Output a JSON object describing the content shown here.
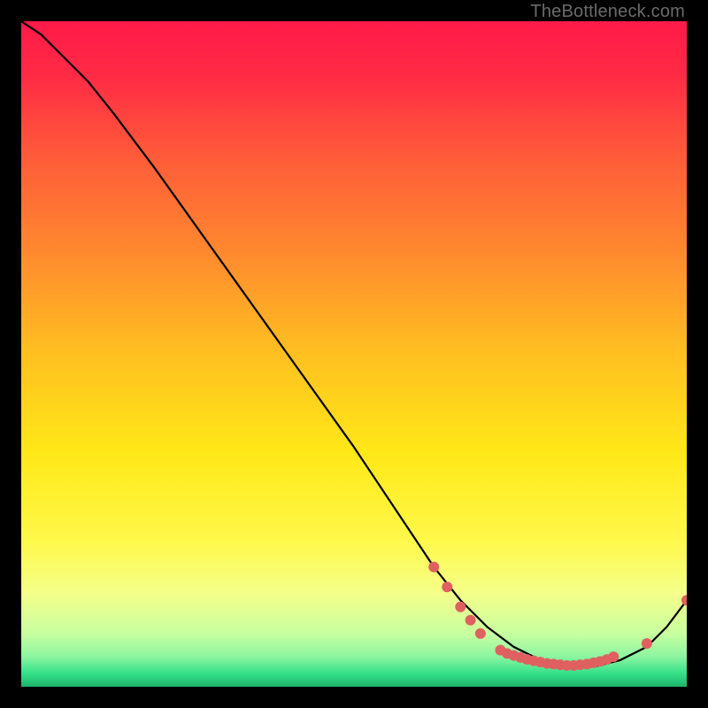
{
  "watermark": "TheBottleneck.com",
  "chart_data": {
    "type": "line",
    "title": "",
    "xlabel": "",
    "ylabel": "",
    "xlim": [
      0,
      100
    ],
    "ylim": [
      0,
      100
    ],
    "grid": false,
    "legend": false,
    "background_gradient": {
      "stops": [
        {
          "pos": 0.0,
          "color": "#ff1a49"
        },
        {
          "pos": 0.08,
          "color": "#ff2a45"
        },
        {
          "pos": 0.2,
          "color": "#ff5a3a"
        },
        {
          "pos": 0.35,
          "color": "#ff8a2e"
        },
        {
          "pos": 0.5,
          "color": "#ffc020"
        },
        {
          "pos": 0.65,
          "color": "#ffe818"
        },
        {
          "pos": 0.78,
          "color": "#fff94a"
        },
        {
          "pos": 0.86,
          "color": "#f4ff8a"
        },
        {
          "pos": 0.92,
          "color": "#c8ffa0"
        },
        {
          "pos": 0.955,
          "color": "#8cf5a0"
        },
        {
          "pos": 0.98,
          "color": "#35e08a"
        },
        {
          "pos": 1.0,
          "color": "#1db36a"
        }
      ]
    },
    "series": [
      {
        "name": "curve",
        "color": "#000000",
        "x": [
          0,
          3,
          6,
          10,
          14,
          20,
          30,
          40,
          50,
          58,
          62,
          66,
          70,
          74,
          78,
          82,
          86,
          90,
          94,
          97,
          100
        ],
        "y": [
          100,
          98,
          95,
          91,
          86,
          78,
          64,
          50,
          36,
          24,
          18,
          13,
          9,
          6,
          4,
          3,
          3,
          4,
          6,
          9,
          13
        ]
      }
    ],
    "markers": {
      "color": "#e06060",
      "radius_main": 6,
      "points": [
        {
          "x": 62,
          "y": 18
        },
        {
          "x": 64,
          "y": 15
        },
        {
          "x": 66,
          "y": 12
        },
        {
          "x": 67.5,
          "y": 10
        },
        {
          "x": 69,
          "y": 8
        },
        {
          "x": 72,
          "y": 5.5
        },
        {
          "x": 73,
          "y": 5.0
        },
        {
          "x": 74,
          "y": 4.7
        },
        {
          "x": 75,
          "y": 4.4
        },
        {
          "x": 76,
          "y": 4.1
        },
        {
          "x": 77,
          "y": 3.9
        },
        {
          "x": 78,
          "y": 3.7
        },
        {
          "x": 79,
          "y": 3.5
        },
        {
          "x": 80,
          "y": 3.4
        },
        {
          "x": 81,
          "y": 3.3
        },
        {
          "x": 82,
          "y": 3.2
        },
        {
          "x": 83,
          "y": 3.2
        },
        {
          "x": 84,
          "y": 3.3
        },
        {
          "x": 85,
          "y": 3.4
        },
        {
          "x": 86,
          "y": 3.6
        },
        {
          "x": 87,
          "y": 3.8
        },
        {
          "x": 88,
          "y": 4.1
        },
        {
          "x": 89,
          "y": 4.5
        },
        {
          "x": 94,
          "y": 6.5
        },
        {
          "x": 100,
          "y": 13
        }
      ]
    }
  }
}
